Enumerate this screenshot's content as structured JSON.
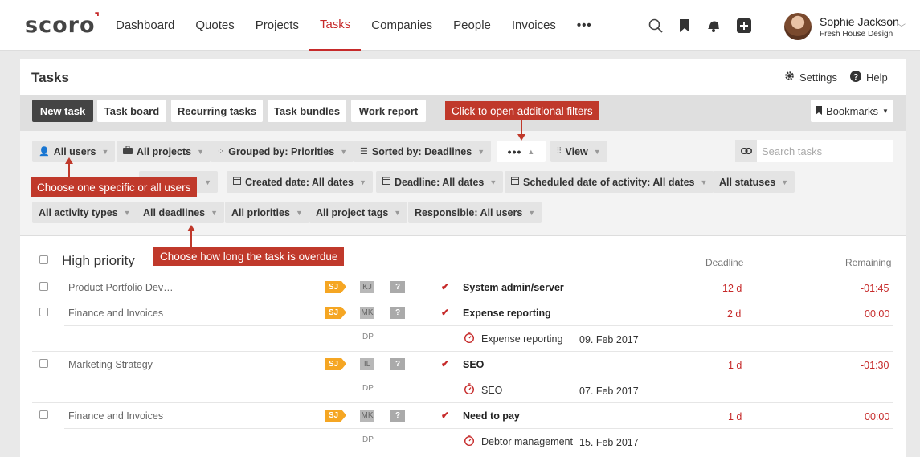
{
  "app": {
    "logo": "scoro"
  },
  "nav": {
    "items": [
      "Dashboard",
      "Quotes",
      "Projects",
      "Tasks",
      "Companies",
      "People",
      "Invoices"
    ],
    "active": "Tasks",
    "more": "•••"
  },
  "user": {
    "name": "Sophie Jackson",
    "company": "Fresh House Design"
  },
  "page": {
    "title": "Tasks",
    "settings": "Settings",
    "help": "Help"
  },
  "toolbar": {
    "new_task": "New task",
    "task_board": "Task board",
    "recurring": "Recurring tasks",
    "bundles": "Task bundles",
    "work_report": "Work report",
    "bookmarks": "Bookmarks"
  },
  "filters": {
    "all_users": "All users",
    "all_projects": "All projects",
    "grouped_by": "Grouped by: Priorities",
    "sorted_by": "Sorted by: Deadlines",
    "more": "•••",
    "view": "View",
    "search_placeholder": "Search tasks",
    "created_date": "Created date: All dates",
    "deadline": "Deadline: All dates",
    "scheduled": "Scheduled date of activity: All dates",
    "statuses": "All statuses",
    "activity_types": "All activity types",
    "deadlines": "All deadlines",
    "priorities": "All priorities",
    "project_tags": "All project tags",
    "responsible": "Responsible: All users"
  },
  "callouts": {
    "filters": "Click to open additional filters",
    "users": "Choose one specific or all users",
    "overdue": "Choose how long the task is overdue"
  },
  "table": {
    "group": "High priority",
    "col_deadline": "Deadline",
    "col_remaining": "Remaining",
    "rows": [
      {
        "project": "Product Portfolio Dev…",
        "assignee": "SJ",
        "owner": "KJ",
        "status": "?",
        "task": "System admin/server",
        "deadline": "12 d",
        "remaining": "-01:45"
      },
      {
        "project": "Finance and Invoices",
        "assignee": "SJ",
        "owner": "MK",
        "status": "?",
        "task": "Expense reporting",
        "deadline": "2 d",
        "remaining": "00:00",
        "activity": {
          "who": "DP",
          "name": "Expense reporting",
          "date": "09. Feb 2017"
        }
      },
      {
        "project": "Marketing Strategy",
        "assignee": "SJ",
        "owner": "IL",
        "status": "?",
        "task": "SEO",
        "deadline": "1 d",
        "remaining": "-01:30",
        "activity": {
          "who": "DP",
          "name": "SEO",
          "date": "07. Feb 2017"
        }
      },
      {
        "project": "Finance and Invoices",
        "assignee": "SJ",
        "owner": "MK",
        "status": "?",
        "task": "Need to pay",
        "deadline": "1 d",
        "remaining": "00:00",
        "activity": {
          "who": "DP",
          "name": "Debtor management",
          "date": "15. Feb 2017"
        }
      }
    ]
  },
  "colors": {
    "accent": "#c62a2a",
    "callout": "#c0392b",
    "badge_user": "#f5a623"
  }
}
